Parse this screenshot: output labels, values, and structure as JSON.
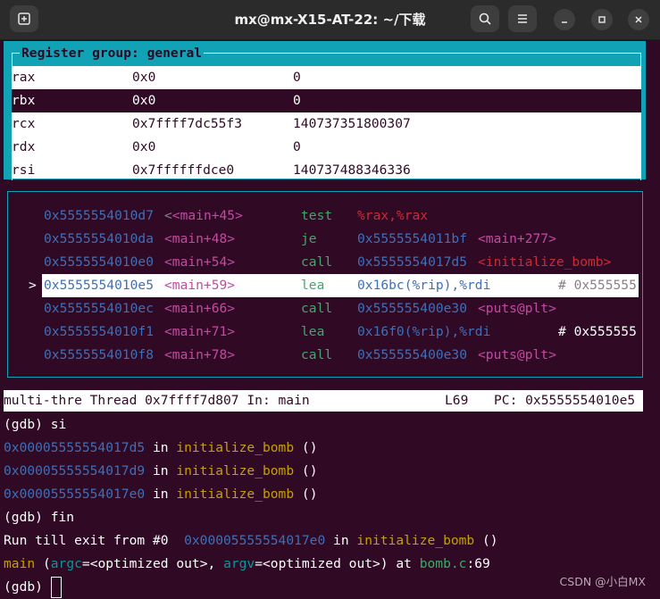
{
  "window": {
    "title": "mx@mx-X15-AT-22: ~/下载"
  },
  "registers": {
    "title": "Register group: general",
    "rows": [
      {
        "name": "rax",
        "hex": "0x0",
        "dec": "0"
      },
      {
        "name": "rbx",
        "hex": "0x0",
        "dec": "0"
      },
      {
        "name": "rcx",
        "hex": "0x7ffff7dc55f3",
        "dec": "140737351800307"
      },
      {
        "name": "rdx",
        "hex": "0x0",
        "dec": "0"
      },
      {
        "name": "rsi",
        "hex": "0x7ffffffdce0",
        "dec": "140737488346336"
      }
    ]
  },
  "asm": {
    "marker": ">",
    "rows": [
      {
        "addr": "0x5555554010d7",
        "sym": "<main+45>",
        "op": "test",
        "args": "%rax,%rax",
        "extra": ""
      },
      {
        "addr": "0x5555554010da",
        "sym": "<main+48>",
        "op": "je",
        "args": "0x5555554011bf",
        "extra": "<main+277>"
      },
      {
        "addr": "0x5555554010e0",
        "sym": "<main+54>",
        "op": "call",
        "args": "0x5555554017d5",
        "extra": "<initialize_bomb>"
      },
      {
        "addr": "0x5555554010e5",
        "sym": "<main+59>",
        "op": "lea",
        "args": "0x16bc(%rip),%rdi",
        "extra": "# 0x555555"
      },
      {
        "addr": "0x5555554010ec",
        "sym": "<main+66>",
        "op": "call",
        "args": "0x555555400e30",
        "extra": "<puts@plt>"
      },
      {
        "addr": "0x5555554010f1",
        "sym": "<main+71>",
        "op": "lea",
        "args": "0x16f0(%rip),%rdi",
        "extra": "# 0x555555"
      },
      {
        "addr": "0x5555554010f8",
        "sym": "<main+78>",
        "op": "call",
        "args": "0x555555400e30",
        "extra": "<puts@plt>"
      }
    ]
  },
  "status": {
    "text": "multi-thre Thread 0x7ffff7d807 In: main",
    "line": "L69",
    "pc": "PC: 0x5555554010e5"
  },
  "console": {
    "prompt": "(gdb)",
    "cmd1": "si",
    "frames": [
      {
        "addr": "0x00005555554017d5",
        "in": "in",
        "fn": "initialize_bomb",
        "args": "()"
      },
      {
        "addr": "0x00005555554017d9",
        "in": "in",
        "fn": "initialize_bomb",
        "args": "()"
      },
      {
        "addr": "0x00005555554017e0",
        "in": "in",
        "fn": "initialize_bomb",
        "args": "()"
      }
    ],
    "cmd2": "fin",
    "run_prefix": "Run till exit from #0",
    "run_addr": "0x00005555554017e0",
    "run_in": "in",
    "run_fn": "initialize_bomb",
    "run_args": "()",
    "main_fn": "main",
    "main_open": "(",
    "argc": "argc",
    "argc_val": "=<optimized out>, ",
    "argv": "argv",
    "argv_val": "=<optimized out>) at ",
    "file": "bomb.c",
    "file_line": ":69"
  },
  "watermark": "CSDN @小白MX",
  "colors": {
    "terminal_bg": "#300a24",
    "accent_cyan": "#11a2b5"
  }
}
